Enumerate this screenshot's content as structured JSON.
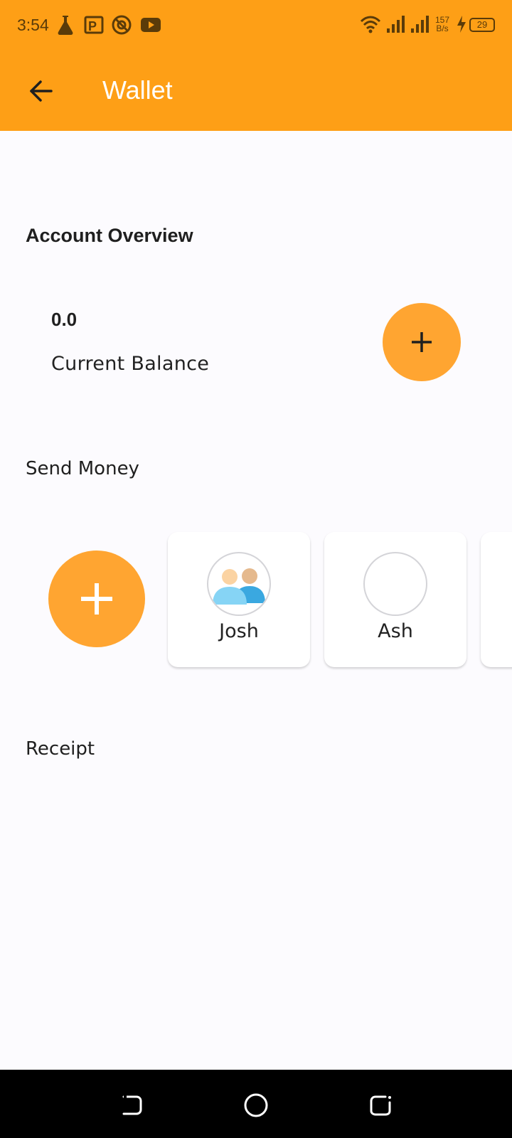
{
  "status_bar": {
    "time": "3:54",
    "net_speed_value": "157",
    "net_speed_unit": "B/s",
    "battery": "29",
    "notification_icons": [
      "flask-icon",
      "parking-app-icon",
      "vpn-icon",
      "youtube-icon"
    ],
    "system_icons": [
      "wifi-icon",
      "signal-icon",
      "signal-icon",
      "charging-icon",
      "battery-icon"
    ]
  },
  "app_bar": {
    "title": "Wallet",
    "back_icon": "arrow-left-icon"
  },
  "account": {
    "section_title": "Account Overview",
    "balance_value": "0.0",
    "balance_label": "Current Balance",
    "add_funds_icon": "plus-icon"
  },
  "send_money": {
    "section_title": "Send Money",
    "add_contact_icon": "plus-icon",
    "contacts": [
      {
        "name": "Josh",
        "avatar": "people-icon"
      },
      {
        "name": "Ash",
        "avatar": ""
      }
    ]
  },
  "receipt": {
    "section_title": "Receipt"
  },
  "nav_bar": {
    "buttons": [
      "back-nav-icon",
      "home-nav-icon",
      "recents-nav-icon"
    ]
  },
  "colors": {
    "accent": "#FE9F16",
    "fab": "#FFA531",
    "background": "#FCFBFE",
    "nav_bar": "#000000"
  }
}
